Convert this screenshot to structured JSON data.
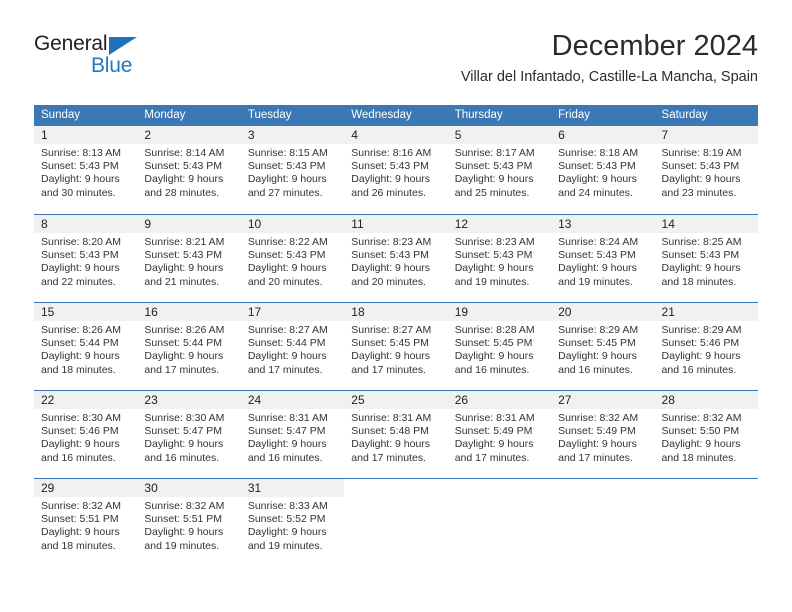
{
  "brand": {
    "name_top": "General",
    "name_bottom": "Blue",
    "accent_color": "#1f7ac4",
    "header_color": "#3c78b4",
    "daynum_band_color": "#f1f1f1"
  },
  "header": {
    "title": "December 2024",
    "subtitle": "Villar del Infantado, Castille-La Mancha, Spain"
  },
  "calendar": {
    "weekdays": [
      "Sunday",
      "Monday",
      "Tuesday",
      "Wednesday",
      "Thursday",
      "Friday",
      "Saturday"
    ],
    "weeks": [
      [
        {
          "day": "1",
          "sunrise": "Sunrise: 8:13 AM",
          "sunset": "Sunset: 5:43 PM",
          "daylight1": "Daylight: 9 hours",
          "daylight2": "and 30 minutes."
        },
        {
          "day": "2",
          "sunrise": "Sunrise: 8:14 AM",
          "sunset": "Sunset: 5:43 PM",
          "daylight1": "Daylight: 9 hours",
          "daylight2": "and 28 minutes."
        },
        {
          "day": "3",
          "sunrise": "Sunrise: 8:15 AM",
          "sunset": "Sunset: 5:43 PM",
          "daylight1": "Daylight: 9 hours",
          "daylight2": "and 27 minutes."
        },
        {
          "day": "4",
          "sunrise": "Sunrise: 8:16 AM",
          "sunset": "Sunset: 5:43 PM",
          "daylight1": "Daylight: 9 hours",
          "daylight2": "and 26 minutes."
        },
        {
          "day": "5",
          "sunrise": "Sunrise: 8:17 AM",
          "sunset": "Sunset: 5:43 PM",
          "daylight1": "Daylight: 9 hours",
          "daylight2": "and 25 minutes."
        },
        {
          "day": "6",
          "sunrise": "Sunrise: 8:18 AM",
          "sunset": "Sunset: 5:43 PM",
          "daylight1": "Daylight: 9 hours",
          "daylight2": "and 24 minutes."
        },
        {
          "day": "7",
          "sunrise": "Sunrise: 8:19 AM",
          "sunset": "Sunset: 5:43 PM",
          "daylight1": "Daylight: 9 hours",
          "daylight2": "and 23 minutes."
        }
      ],
      [
        {
          "day": "8",
          "sunrise": "Sunrise: 8:20 AM",
          "sunset": "Sunset: 5:43 PM",
          "daylight1": "Daylight: 9 hours",
          "daylight2": "and 22 minutes."
        },
        {
          "day": "9",
          "sunrise": "Sunrise: 8:21 AM",
          "sunset": "Sunset: 5:43 PM",
          "daylight1": "Daylight: 9 hours",
          "daylight2": "and 21 minutes."
        },
        {
          "day": "10",
          "sunrise": "Sunrise: 8:22 AM",
          "sunset": "Sunset: 5:43 PM",
          "daylight1": "Daylight: 9 hours",
          "daylight2": "and 20 minutes."
        },
        {
          "day": "11",
          "sunrise": "Sunrise: 8:23 AM",
          "sunset": "Sunset: 5:43 PM",
          "daylight1": "Daylight: 9 hours",
          "daylight2": "and 20 minutes."
        },
        {
          "day": "12",
          "sunrise": "Sunrise: 8:23 AM",
          "sunset": "Sunset: 5:43 PM",
          "daylight1": "Daylight: 9 hours",
          "daylight2": "and 19 minutes."
        },
        {
          "day": "13",
          "sunrise": "Sunrise: 8:24 AM",
          "sunset": "Sunset: 5:43 PM",
          "daylight1": "Daylight: 9 hours",
          "daylight2": "and 19 minutes."
        },
        {
          "day": "14",
          "sunrise": "Sunrise: 8:25 AM",
          "sunset": "Sunset: 5:43 PM",
          "daylight1": "Daylight: 9 hours",
          "daylight2": "and 18 minutes."
        }
      ],
      [
        {
          "day": "15",
          "sunrise": "Sunrise: 8:26 AM",
          "sunset": "Sunset: 5:44 PM",
          "daylight1": "Daylight: 9 hours",
          "daylight2": "and 18 minutes."
        },
        {
          "day": "16",
          "sunrise": "Sunrise: 8:26 AM",
          "sunset": "Sunset: 5:44 PM",
          "daylight1": "Daylight: 9 hours",
          "daylight2": "and 17 minutes."
        },
        {
          "day": "17",
          "sunrise": "Sunrise: 8:27 AM",
          "sunset": "Sunset: 5:44 PM",
          "daylight1": "Daylight: 9 hours",
          "daylight2": "and 17 minutes."
        },
        {
          "day": "18",
          "sunrise": "Sunrise: 8:27 AM",
          "sunset": "Sunset: 5:45 PM",
          "daylight1": "Daylight: 9 hours",
          "daylight2": "and 17 minutes."
        },
        {
          "day": "19",
          "sunrise": "Sunrise: 8:28 AM",
          "sunset": "Sunset: 5:45 PM",
          "daylight1": "Daylight: 9 hours",
          "daylight2": "and 16 minutes."
        },
        {
          "day": "20",
          "sunrise": "Sunrise: 8:29 AM",
          "sunset": "Sunset: 5:45 PM",
          "daylight1": "Daylight: 9 hours",
          "daylight2": "and 16 minutes."
        },
        {
          "day": "21",
          "sunrise": "Sunrise: 8:29 AM",
          "sunset": "Sunset: 5:46 PM",
          "daylight1": "Daylight: 9 hours",
          "daylight2": "and 16 minutes."
        }
      ],
      [
        {
          "day": "22",
          "sunrise": "Sunrise: 8:30 AM",
          "sunset": "Sunset: 5:46 PM",
          "daylight1": "Daylight: 9 hours",
          "daylight2": "and 16 minutes."
        },
        {
          "day": "23",
          "sunrise": "Sunrise: 8:30 AM",
          "sunset": "Sunset: 5:47 PM",
          "daylight1": "Daylight: 9 hours",
          "daylight2": "and 16 minutes."
        },
        {
          "day": "24",
          "sunrise": "Sunrise: 8:31 AM",
          "sunset": "Sunset: 5:47 PM",
          "daylight1": "Daylight: 9 hours",
          "daylight2": "and 16 minutes."
        },
        {
          "day": "25",
          "sunrise": "Sunrise: 8:31 AM",
          "sunset": "Sunset: 5:48 PM",
          "daylight1": "Daylight: 9 hours",
          "daylight2": "and 17 minutes."
        },
        {
          "day": "26",
          "sunrise": "Sunrise: 8:31 AM",
          "sunset": "Sunset: 5:49 PM",
          "daylight1": "Daylight: 9 hours",
          "daylight2": "and 17 minutes."
        },
        {
          "day": "27",
          "sunrise": "Sunrise: 8:32 AM",
          "sunset": "Sunset: 5:49 PM",
          "daylight1": "Daylight: 9 hours",
          "daylight2": "and 17 minutes."
        },
        {
          "day": "28",
          "sunrise": "Sunrise: 8:32 AM",
          "sunset": "Sunset: 5:50 PM",
          "daylight1": "Daylight: 9 hours",
          "daylight2": "and 18 minutes."
        }
      ],
      [
        {
          "day": "29",
          "sunrise": "Sunrise: 8:32 AM",
          "sunset": "Sunset: 5:51 PM",
          "daylight1": "Daylight: 9 hours",
          "daylight2": "and 18 minutes."
        },
        {
          "day": "30",
          "sunrise": "Sunrise: 8:32 AM",
          "sunset": "Sunset: 5:51 PM",
          "daylight1": "Daylight: 9 hours",
          "daylight2": "and 19 minutes."
        },
        {
          "day": "31",
          "sunrise": "Sunrise: 8:33 AM",
          "sunset": "Sunset: 5:52 PM",
          "daylight1": "Daylight: 9 hours",
          "daylight2": "and 19 minutes."
        },
        {
          "day": "",
          "sunrise": "",
          "sunset": "",
          "daylight1": "",
          "daylight2": ""
        },
        {
          "day": "",
          "sunrise": "",
          "sunset": "",
          "daylight1": "",
          "daylight2": ""
        },
        {
          "day": "",
          "sunrise": "",
          "sunset": "",
          "daylight1": "",
          "daylight2": ""
        },
        {
          "day": "",
          "sunrise": "",
          "sunset": "",
          "daylight1": "",
          "daylight2": ""
        }
      ]
    ]
  }
}
